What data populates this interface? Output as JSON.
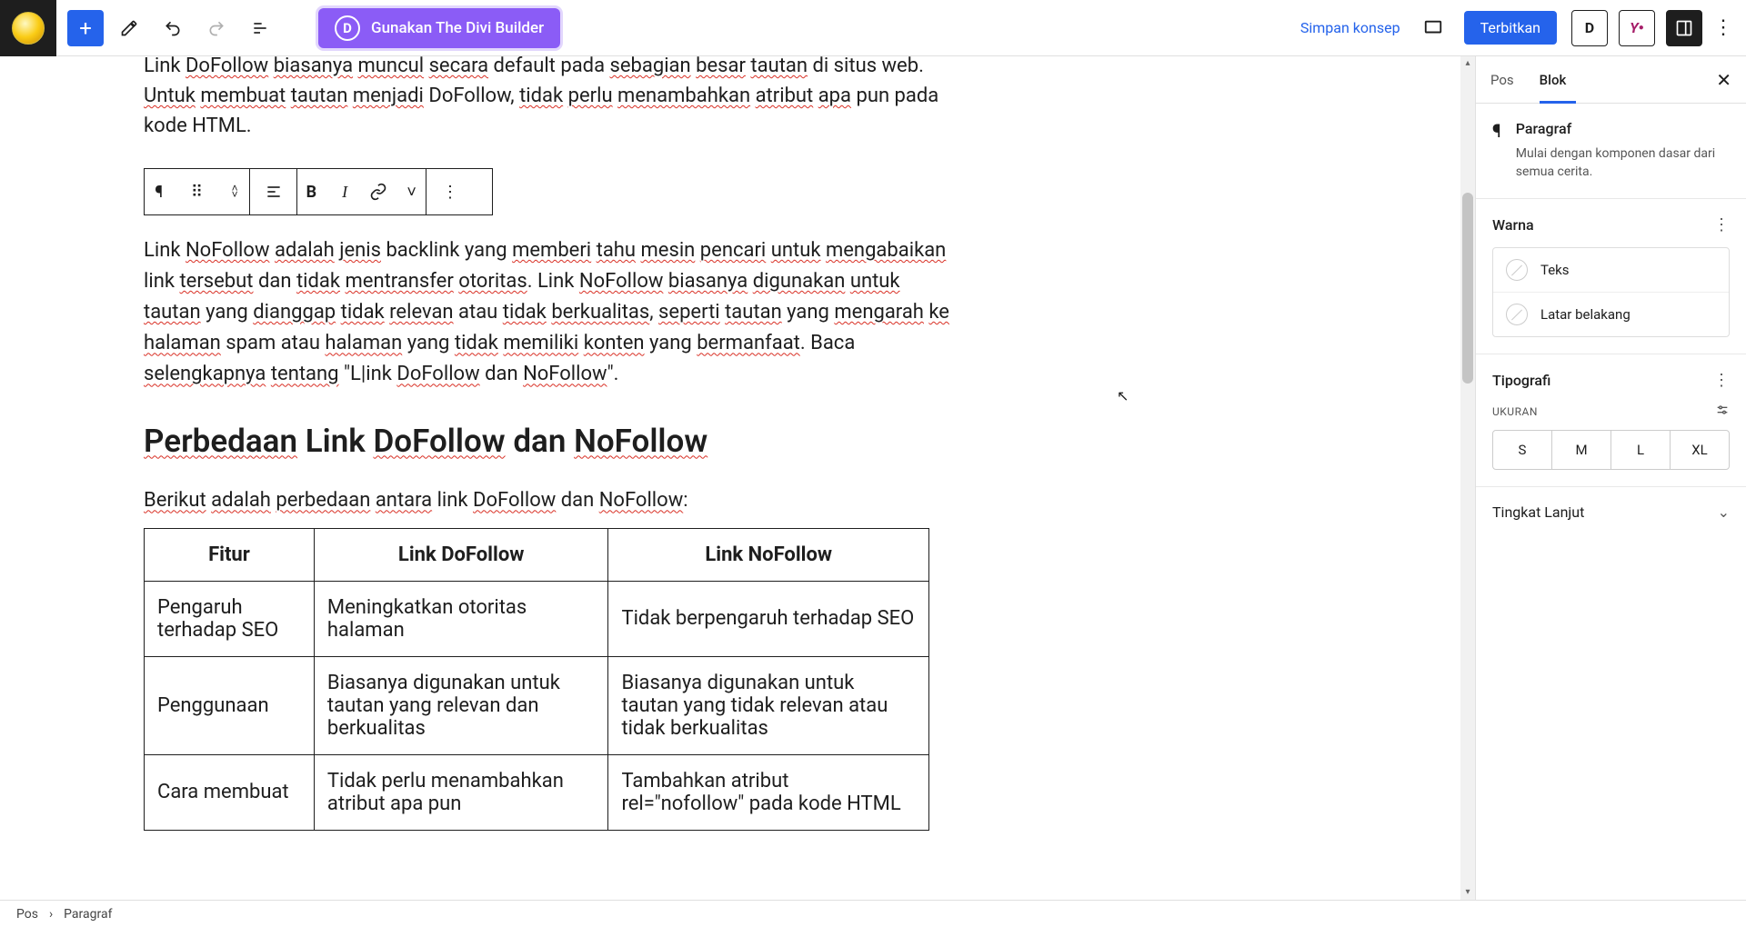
{
  "topbar": {
    "divi_label": "Gunakan The Divi Builder",
    "save_draft": "Simpan konsep",
    "publish": "Terbitkan"
  },
  "content": {
    "intro_para": "Link DoFollow biasanya muncul secara default pada sebagian besar tautan di situs web. Untuk membuat tautan menjadi DoFollow, tidak perlu menambahkan atribut apa pun pada kode HTML.",
    "nofollow_para_1": "Link NoFollow adalah jenis backlink yang memberi tahu mesin pencari untuk mengabaikan link tersebut dan tidak mentransfer otoritas. Link NoFollow biasanya digunakan untuk tautan yang dianggap tidak relevan atau tidak berkualitas, seperti tautan yang mengarah ke halaman spam atau halaman yang tidak memiliki konten yang bermanfaat. Baca selengkapnya tentang \"Link DoFollow dan NoFollow\".",
    "h2": "Perbedaan Link DoFollow dan NoFollow",
    "lead": "Berikut adalah perbedaan antara link DoFollow dan NoFollow:",
    "table": {
      "headers": [
        "Fitur",
        "Link DoFollow",
        "Link NoFollow"
      ],
      "rows": [
        [
          "Pengaruh terhadap SEO",
          "Meningkatkan otoritas halaman",
          "Tidak berpengaruh terhadap SEO"
        ],
        [
          "Penggunaan",
          "Biasanya digunakan untuk tautan yang relevan dan berkualitas",
          "Biasanya digunakan untuk tautan yang tidak relevan atau tidak berkualitas"
        ],
        [
          "Cara membuat",
          "Tidak perlu menambahkan atribut apa pun",
          "Tambahkan atribut rel=\"nofollow\" pada kode HTML"
        ]
      ]
    }
  },
  "sidebar": {
    "tab_pos": "Pos",
    "tab_blok": "Blok",
    "block_name": "Paragraf",
    "block_desc": "Mulai dengan komponen dasar dari semua cerita.",
    "warna": "Warna",
    "teks": "Teks",
    "latar": "Latar belakang",
    "tipografi": "Tipografi",
    "ukuran": "UKURAN",
    "sizes": [
      "S",
      "M",
      "L",
      "XL"
    ],
    "advanced": "Tingkat Lanjut"
  },
  "breadcrumb": {
    "root": "Pos",
    "current": "Paragraf"
  }
}
